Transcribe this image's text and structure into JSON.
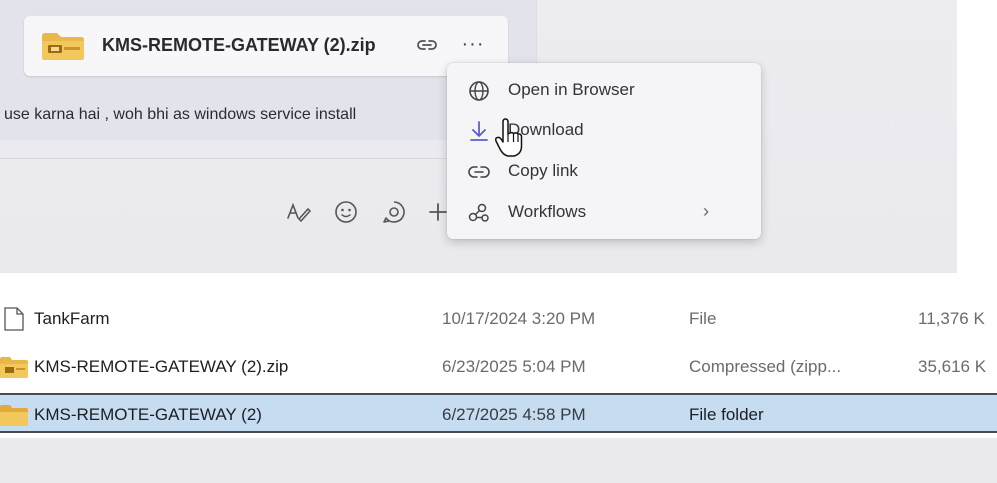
{
  "teams": {
    "attachment": {
      "name": "KMS-REMOTE-GATEWAY (2).zip",
      "more_label": "···",
      "icons": [
        "zip-folder-icon",
        "link-icon"
      ]
    },
    "message_text": "use karna hai , woh bhi as windows service install",
    "compose_toolbar": {
      "icons": [
        "format-text-icon",
        "emoji-icon",
        "loop-icon",
        "plus-icon"
      ]
    }
  },
  "context_menu": {
    "items": [
      {
        "label": "Open in Browser",
        "icon": "globe-icon"
      },
      {
        "label": "Download",
        "icon": "download-icon"
      },
      {
        "label": "Copy link",
        "icon": "link-icon"
      },
      {
        "label": "Workflows",
        "icon": "workflows-icon",
        "chevron": "›"
      }
    ]
  },
  "explorer": {
    "rows": [
      {
        "name": "TankFarm",
        "date": "10/17/2024 3:20 PM",
        "type": "File",
        "size": "11,376 K",
        "icon": "file-icon",
        "selected": false
      },
      {
        "name": "KMS-REMOTE-GATEWAY (2).zip",
        "date": "6/23/2025 5:04 PM",
        "type": "Compressed (zipp...",
        "size": "35,616 K",
        "icon": "zip-folder-icon",
        "selected": false
      },
      {
        "name": "KMS-REMOTE-GATEWAY (2)",
        "date": "6/27/2025 4:58 PM",
        "type": "File folder",
        "size": "",
        "icon": "folder-icon",
        "selected": true
      }
    ]
  },
  "colors": {
    "selection": "#c6dcf0",
    "folder": "#e8b84a",
    "accent": "#5b5fc7"
  }
}
